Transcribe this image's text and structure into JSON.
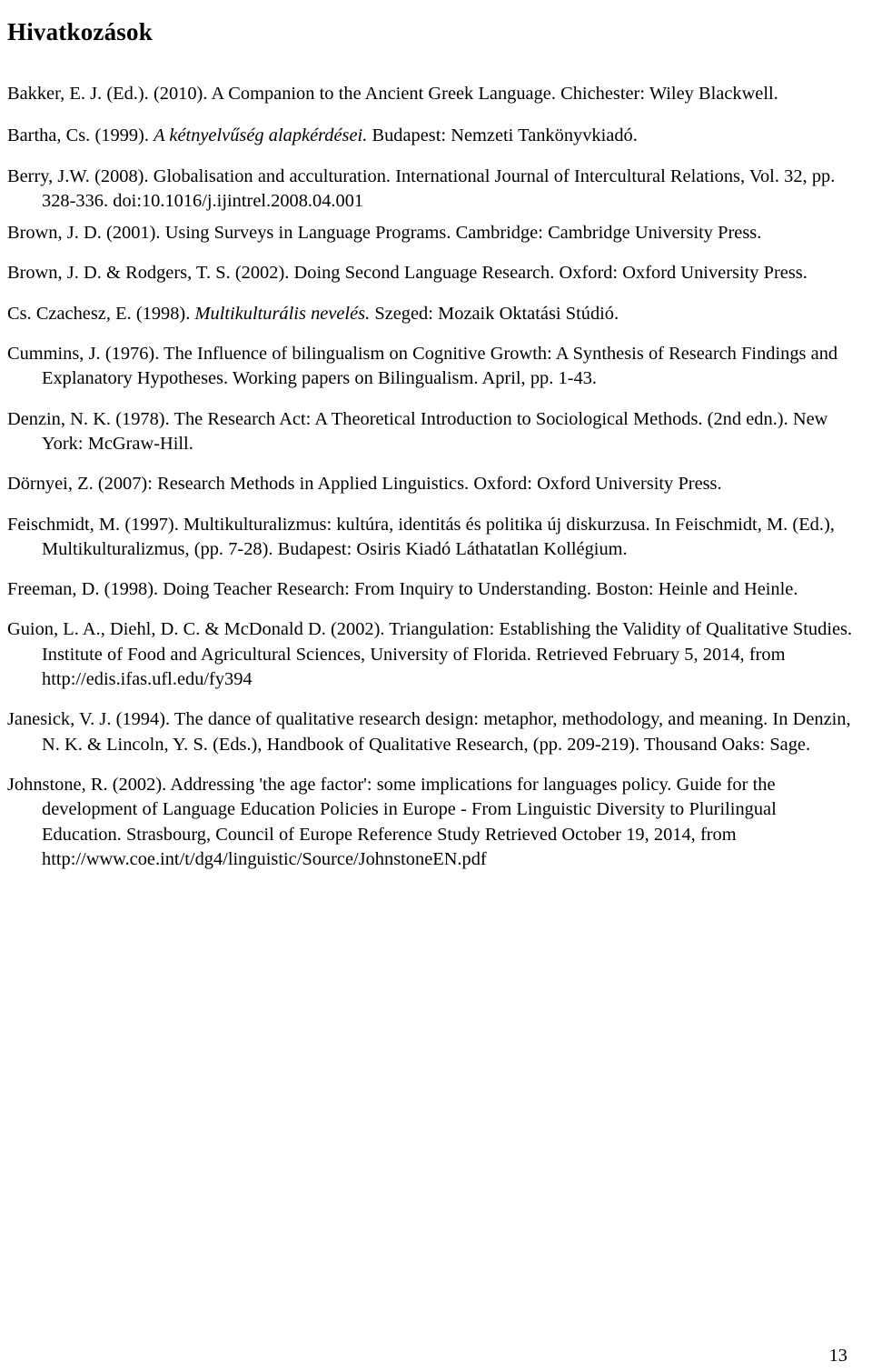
{
  "document": {
    "heading": "Hivatkozások",
    "page_number": "13",
    "references": [
      {
        "id": "bakker-2010",
        "gap": "gap-none",
        "parts": [
          {
            "text": "Bakker, E. J. (Ed.). (2010). A Companion to the Ancient Greek Language. Chichester: Wiley Blackwell.",
            "style": "normal"
          }
        ]
      },
      {
        "id": "bartha-1999",
        "gap": "gap-large",
        "parts": [
          {
            "text": "Bartha, Cs. (1999). ",
            "style": "normal"
          },
          {
            "text": "A kétnyelvűség alapkérdései.",
            "style": "italic"
          },
          {
            "text": " Budapest: Nemzeti Tankönyvkiadó.",
            "style": "normal"
          }
        ]
      },
      {
        "id": "berry-2008",
        "gap": "gap-small",
        "parts": [
          {
            "text": "Berry, J.W. (2008). Globalisation and acculturation. International Journal of Intercultural Relations, Vol. 32, pp. 328-336. doi:10.1016/j.ijintrel.2008.04.001",
            "style": "normal"
          }
        ]
      },
      {
        "id": "brown-2001",
        "gap": "gap-tiny",
        "parts": [
          {
            "text": "Brown, J. D. (2001). Using Surveys in Language Programs. Cambridge: Cambridge University Press.",
            "style": "normal"
          }
        ]
      },
      {
        "id": "brown-rodgers-2002",
        "gap": "gap-small",
        "parts": [
          {
            "text": "Brown, J. D. & Rodgers, T. S. (2002). Doing Second Language Research. Oxford: Oxford University Press.",
            "style": "normal"
          }
        ]
      },
      {
        "id": "czachesz-1998",
        "gap": "gap-small",
        "parts": [
          {
            "text": "Cs. Czachesz, E. (1998). ",
            "style": "normal"
          },
          {
            "text": "Multikulturális nevelés.",
            "style": "italic"
          },
          {
            "text": " Szeged: Mozaik Oktatási Stúdió.",
            "style": "normal"
          }
        ]
      },
      {
        "id": "cummins-1976",
        "gap": "gap-small",
        "parts": [
          {
            "text": "Cummins, J. (1976). The Influence of bilingualism on Cognitive Growth: A Synthesis of Research Findings and Explanatory Hypotheses. Working papers on Bilingualism. April, pp. 1-43.",
            "style": "normal"
          }
        ]
      },
      {
        "id": "denzin-1978",
        "gap": "gap-small",
        "parts": [
          {
            "text": "Denzin, N. K. (1978). The Research Act: A Theoretical Introduction to Sociological Methods. (2nd edn.). New York: McGraw-Hill.",
            "style": "normal"
          }
        ]
      },
      {
        "id": "dornyei-2007",
        "gap": "gap-small",
        "parts": [
          {
            "text": "Dörnyei, Z. (2007): Research Methods in Applied Linguistics. Oxford: Oxford University Press.",
            "style": "normal"
          }
        ]
      },
      {
        "id": "feischmidt-1997",
        "gap": "gap-small",
        "parts": [
          {
            "text": "Feischmidt, M. (1997). Multikulturalizmus: kultúra, identitás és politika új diskurzusa. In Feischmidt, M. (Ed.), Multikulturalizmus, (pp. 7-28). Budapest: Osiris Kiadó Láthatatlan Kollégium.",
            "style": "normal"
          }
        ]
      },
      {
        "id": "freeman-1998",
        "gap": "gap-small",
        "parts": [
          {
            "text": "Freeman, D. (1998). Doing Teacher Research: From Inquiry to Understanding. Boston: Heinle and Heinle.",
            "style": "normal"
          }
        ]
      },
      {
        "id": "guion-2002",
        "gap": "gap-small",
        "parts": [
          {
            "text": "Guion, L. A., Diehl, D. C. & McDonald D. (2002). Triangulation: Establishing the Validity of Qualitative Studies. Institute of Food and Agricultural Sciences, University of Florida. Retrieved February 5, 2014, from http://edis.ifas.ufl.edu/fy394",
            "style": "normal"
          }
        ]
      },
      {
        "id": "janesick-1994",
        "gap": "gap-small",
        "parts": [
          {
            "text": "Janesick, V. J. (1994). The dance of qualitative research design: metaphor, methodology, and meaning. In Denzin, N. K. & Lincoln, Y. S. (Eds.), Handbook of Qualitative Research, (pp. 209-219). Thousand Oaks: Sage.",
            "style": "normal"
          }
        ]
      },
      {
        "id": "johnstone-2002",
        "gap": "gap-small",
        "parts": [
          {
            "text": "Johnstone, R. (2002). Addressing 'the age factor': some implications for languages policy. Guide for the development of Language Education Policies in Europe  - From Linguistic Diversity to Plurilingual Education. Strasbourg, Council of Europe Reference Study Retrieved October 19, 2014, from http://www.coe.int/t/dg4/linguistic/Source/JohnstoneEN.pdf",
            "style": "normal"
          }
        ]
      }
    ]
  }
}
